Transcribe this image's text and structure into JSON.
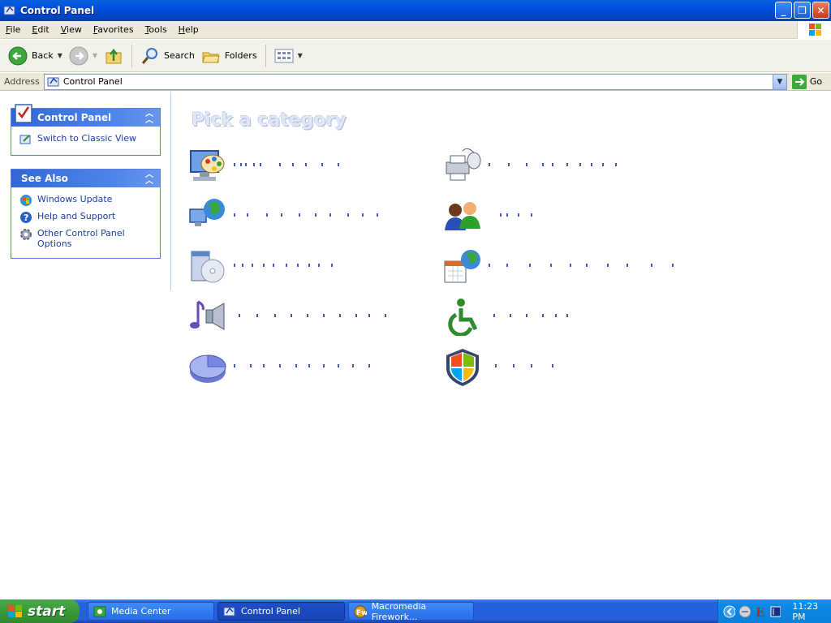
{
  "window": {
    "title": "Control Panel",
    "buttons": {
      "minimize": "_",
      "maximize": "❐",
      "close": "✕"
    }
  },
  "menu": {
    "items": [
      "File",
      "Edit",
      "View",
      "Favorites",
      "Tools",
      "Help"
    ]
  },
  "toolbar": {
    "back_label": "Back",
    "search_label": "Search",
    "folders_label": "Folders"
  },
  "address": {
    "label": "Address",
    "value": "Control Panel",
    "go_label": "Go"
  },
  "sidebar": {
    "control_panel": {
      "title": "Control Panel",
      "links": [
        "Switch to Classic View"
      ]
    },
    "see_also": {
      "title": "See Also",
      "links": [
        "Windows Update",
        "Help and Support",
        "Other Control Panel Options"
      ]
    }
  },
  "main": {
    "heading": "Pick a category"
  },
  "taskbar": {
    "start_label": "start",
    "tasks": [
      "Media Center",
      "Control Panel",
      "Macromedia Firework..."
    ],
    "clock": "11:23 PM"
  },
  "colors": {
    "accent": "#0054e3",
    "link": "#1a3fa8",
    "taskbar": "#245edb",
    "start": "#3c9d3c"
  }
}
